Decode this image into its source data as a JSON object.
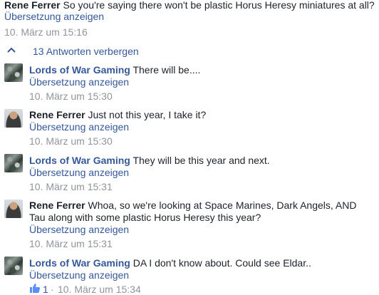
{
  "top_comment": {
    "author": "Rene Ferrer",
    "text": "So you're saying there won't be plastic Horus Heresy miniatures at all?",
    "translate": "Übersetzung anzeigen",
    "time": "10. März um 15:16"
  },
  "replies_toggle": {
    "label": "13 Antworten verbergen",
    "icon": "chevron-up-icon"
  },
  "replies": [
    {
      "author": "Lords of War Gaming",
      "avatar": "lords-avatar",
      "text": "There will be....",
      "translate": "Übersetzung anzeigen",
      "time": "10. März um 15:30"
    },
    {
      "author": "Rene Ferrer",
      "avatar": "rene-avatar",
      "text": "Just not this year, I take it?",
      "translate": "Übersetzung anzeigen",
      "time": "10. März um 15:30"
    },
    {
      "author": "Lords of War Gaming",
      "avatar": "lords-avatar",
      "text": "They will be this year and next.",
      "translate": "Übersetzung anzeigen",
      "time": "10. März um 15:31"
    },
    {
      "author": "Rene Ferrer",
      "avatar": "rene-avatar",
      "text": "Whoa, so we're looking at Space Marines, Dark Angels, AND",
      "text_line2": "Tau along with some plastic Horus Heresy this year?",
      "translate": "Übersetzung anzeigen",
      "time": "10. März um 15:31"
    },
    {
      "author": "Lords of War Gaming",
      "avatar": "lords-avatar",
      "text": "DA I don't know about. Could see Eldar..",
      "translate": "Übersetzung anzeigen",
      "like_count": "1",
      "separator": "·",
      "time": "10. März um 15:34"
    }
  ],
  "colors": {
    "link": "#365899",
    "text": "#1d2129",
    "meta": "#90949c"
  }
}
